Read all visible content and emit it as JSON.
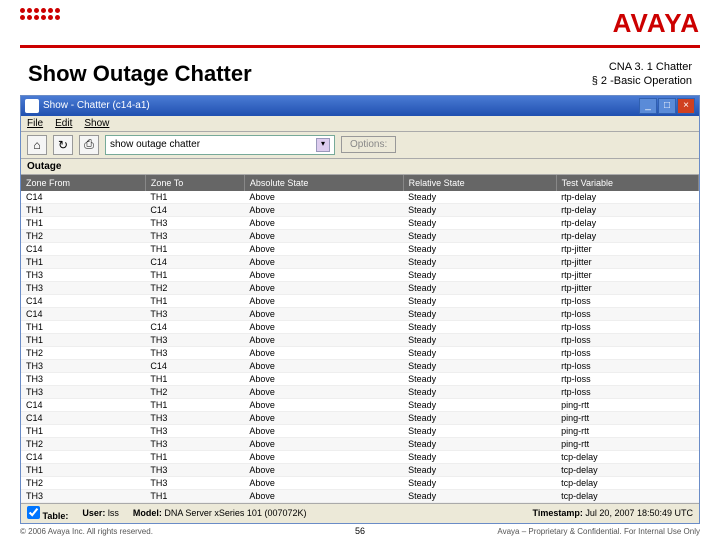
{
  "logo": "AVAYA",
  "title": "Show Outage Chatter",
  "subtitle1": "CNA 3. 1 Chatter",
  "subtitle2": "§ 2 -Basic Operation",
  "win_title": "Show - Chatter (c14-a1)",
  "menu": {
    "file": "File",
    "edit": "Edit",
    "show": "Show"
  },
  "combo": "show outage chatter",
  "options": "Options:",
  "section": "Outage",
  "columns": [
    "Zone From",
    "Zone To",
    "Absolute State",
    "Relative State",
    "Test Variable"
  ],
  "rows": [
    [
      "C14",
      "TH1",
      "Above",
      "Steady",
      "rtp-delay"
    ],
    [
      "TH1",
      "C14",
      "Above",
      "Steady",
      "rtp-delay"
    ],
    [
      "TH1",
      "TH3",
      "Above",
      "Steady",
      "rtp-delay"
    ],
    [
      "TH2",
      "TH3",
      "Above",
      "Steady",
      "rtp-delay"
    ],
    [
      "C14",
      "TH1",
      "Above",
      "Steady",
      "rtp-jitter"
    ],
    [
      "TH1",
      "C14",
      "Above",
      "Steady",
      "rtp-jitter"
    ],
    [
      "TH3",
      "TH1",
      "Above",
      "Steady",
      "rtp-jitter"
    ],
    [
      "TH3",
      "TH2",
      "Above",
      "Steady",
      "rtp-jitter"
    ],
    [
      "C14",
      "TH1",
      "Above",
      "Steady",
      "rtp-loss"
    ],
    [
      "C14",
      "TH3",
      "Above",
      "Steady",
      "rtp-loss"
    ],
    [
      "TH1",
      "C14",
      "Above",
      "Steady",
      "rtp-loss"
    ],
    [
      "TH1",
      "TH3",
      "Above",
      "Steady",
      "rtp-loss"
    ],
    [
      "TH2",
      "TH3",
      "Above",
      "Steady",
      "rtp-loss"
    ],
    [
      "TH3",
      "C14",
      "Above",
      "Steady",
      "rtp-loss"
    ],
    [
      "TH3",
      "TH1",
      "Above",
      "Steady",
      "rtp-loss"
    ],
    [
      "TH3",
      "TH2",
      "Above",
      "Steady",
      "rtp-loss"
    ],
    [
      "C14",
      "TH1",
      "Above",
      "Steady",
      "ping-rtt"
    ],
    [
      "C14",
      "TH3",
      "Above",
      "Steady",
      "ping-rtt"
    ],
    [
      "TH1",
      "TH3",
      "Above",
      "Steady",
      "ping-rtt"
    ],
    [
      "TH2",
      "TH3",
      "Above",
      "Steady",
      "ping-rtt"
    ],
    [
      "C14",
      "TH1",
      "Above",
      "Steady",
      "tcp-delay"
    ],
    [
      "TH1",
      "TH3",
      "Above",
      "Steady",
      "tcp-delay"
    ],
    [
      "TH2",
      "TH3",
      "Above",
      "Steady",
      "tcp-delay"
    ],
    [
      "TH3",
      "TH1",
      "Above",
      "Steady",
      "tcp-delay"
    ]
  ],
  "status": {
    "table": "Table:",
    "user_l": "User:",
    "user_v": "lss",
    "model_l": "Model:",
    "model_v": "DNA Server xSeries 101 (007072K)",
    "ts_l": "Timestamp:",
    "ts_v": "Jul 20, 2007 18:50:49 UTC"
  },
  "footer_left": "© 2006 Avaya Inc. All rights reserved.",
  "footer_right": "Avaya – Proprietary & Confidential. For Internal Use Only",
  "pagenum": "56"
}
